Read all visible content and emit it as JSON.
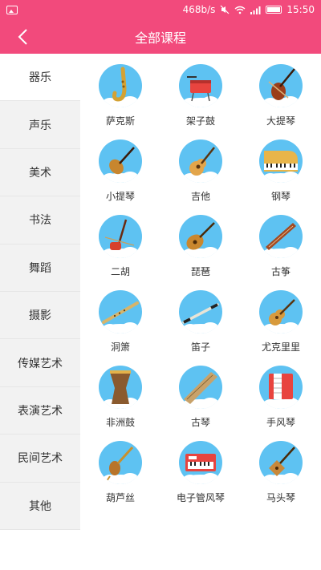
{
  "status": {
    "speed": "468b/s",
    "time": "15:50"
  },
  "header": {
    "title": "全部课程"
  },
  "sidebar": {
    "items": [
      {
        "label": "器乐"
      },
      {
        "label": "声乐"
      },
      {
        "label": "美术"
      },
      {
        "label": "书法"
      },
      {
        "label": "舞蹈"
      },
      {
        "label": "摄影"
      },
      {
        "label": "传媒艺术"
      },
      {
        "label": "表演艺术"
      },
      {
        "label": "民间艺术"
      },
      {
        "label": "其他"
      }
    ],
    "active": "器乐"
  },
  "instruments": [
    {
      "label": "萨克斯",
      "icon": "saxophone-icon"
    },
    {
      "label": "架子鼓",
      "icon": "drum-kit-icon"
    },
    {
      "label": "大提琴",
      "icon": "cello-icon"
    },
    {
      "label": "小提琴",
      "icon": "violin-icon"
    },
    {
      "label": "吉他",
      "icon": "guitar-icon"
    },
    {
      "label": "钢琴",
      "icon": "piano-icon"
    },
    {
      "label": "二胡",
      "icon": "erhu-icon"
    },
    {
      "label": "琵琶",
      "icon": "pipa-icon"
    },
    {
      "label": "古筝",
      "icon": "guzheng-icon"
    },
    {
      "label": "洞箫",
      "icon": "dongxiao-icon"
    },
    {
      "label": "笛子",
      "icon": "flute-icon"
    },
    {
      "label": "尤克里里",
      "icon": "ukulele-icon"
    },
    {
      "label": "非洲鼓",
      "icon": "djembe-icon"
    },
    {
      "label": "古琴",
      "icon": "guqin-icon"
    },
    {
      "label": "手风琴",
      "icon": "accordion-icon"
    },
    {
      "label": "葫芦丝",
      "icon": "hulusi-icon"
    },
    {
      "label": "电子管风琴",
      "icon": "electronic-organ-icon"
    },
    {
      "label": "马头琴",
      "icon": "morin-khuur-icon"
    }
  ],
  "colors": {
    "brand": "#f24a7c",
    "icon_bg": "#5ec2f2"
  }
}
